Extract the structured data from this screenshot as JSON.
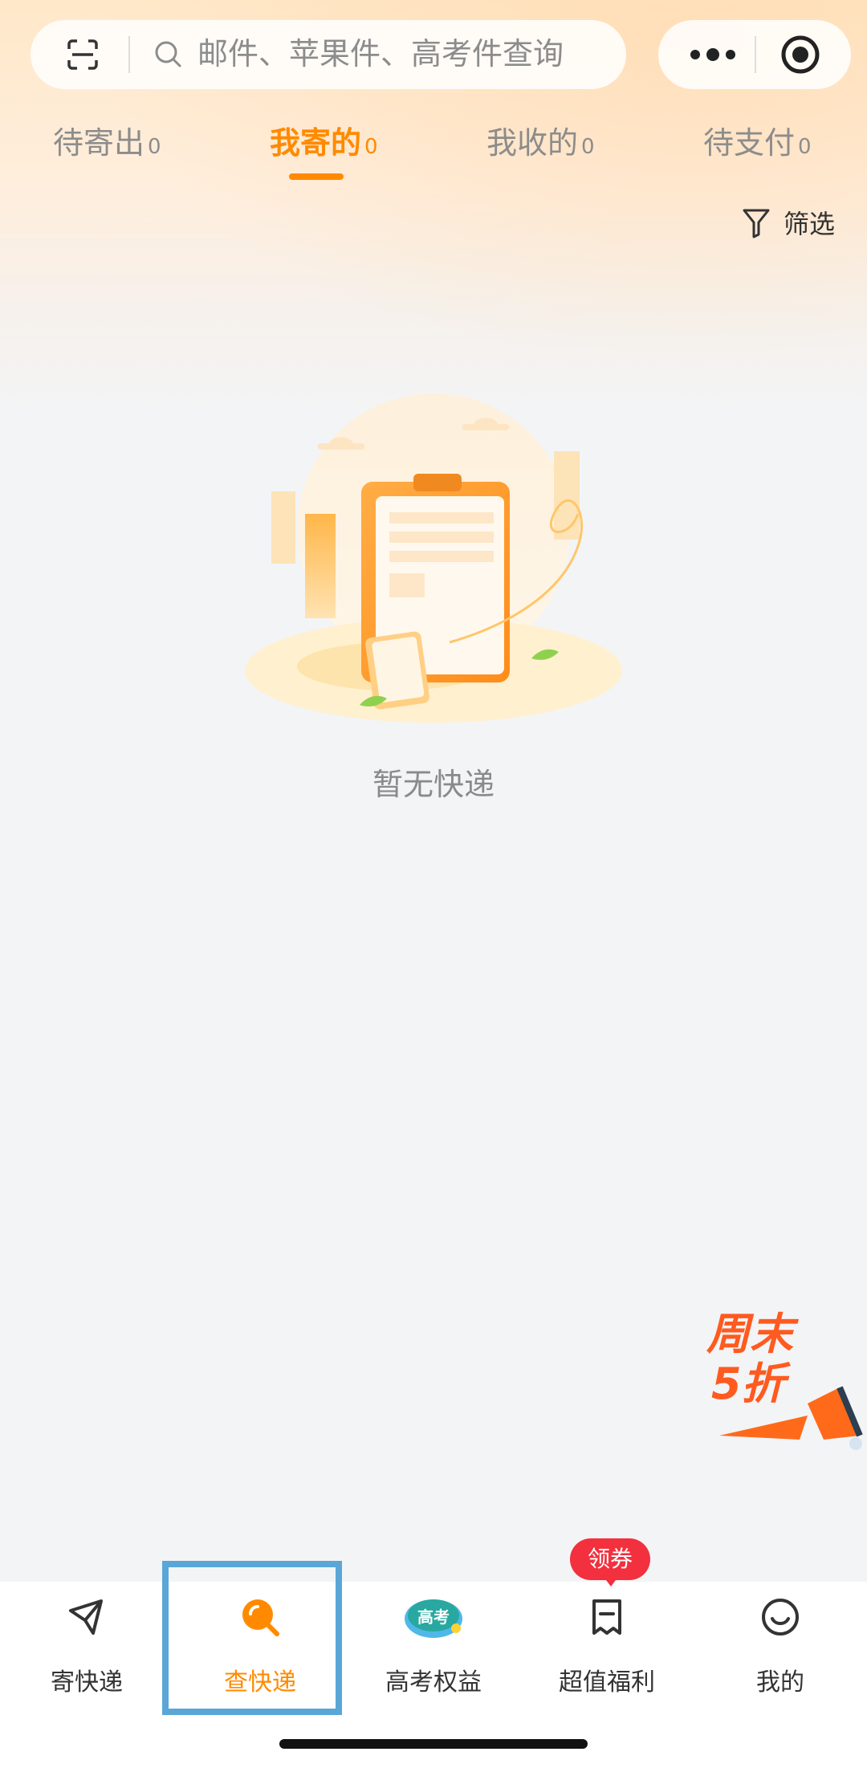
{
  "search": {
    "placeholder": "邮件、苹果件、高考件查询",
    "scan_icon": "scan-icon",
    "search_icon": "search-icon"
  },
  "capsule": {
    "more_icon": "more-dots-icon",
    "close_icon": "target-icon"
  },
  "tabs": [
    {
      "label": "待寄出",
      "count": "0",
      "active": false
    },
    {
      "label": "我寄的",
      "count": "0",
      "active": true
    },
    {
      "label": "我收的",
      "count": "0",
      "active": false
    },
    {
      "label": "待支付",
      "count": "0",
      "active": false
    }
  ],
  "filter": {
    "label": "筛选",
    "icon": "filter-icon"
  },
  "empty_state": {
    "message": "暂无快递",
    "illustration": "clipboard-illustration"
  },
  "promo": {
    "line1": "周末",
    "line2": "5折",
    "icon": "megaphone-icon"
  },
  "bottom_nav": {
    "items": [
      {
        "label": "寄快递",
        "icon": "send-plane-icon",
        "active": false
      },
      {
        "label": "查快递",
        "icon": "search-magnifier-icon",
        "active": true
      },
      {
        "label": "高考权益",
        "icon": "gaokao-badge-icon",
        "icon_text": "高考",
        "active": false
      },
      {
        "label": "超值福利",
        "icon": "coupon-icon",
        "active": false
      },
      {
        "label": "我的",
        "icon": "smile-icon",
        "active": false
      }
    ],
    "badge": "领券"
  },
  "colors": {
    "accent": "#ff8a00",
    "badge": "#f3303e",
    "highlight": "#5aa6d6"
  }
}
